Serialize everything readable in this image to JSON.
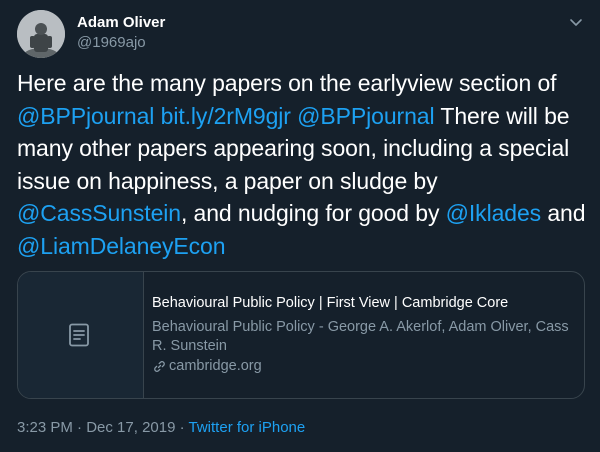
{
  "author": {
    "display_name": "Adam Oliver",
    "handle": "@1969ajo"
  },
  "tweet": {
    "segments": [
      {
        "text": "Here are the many papers on the earlyview section of ",
        "link": false
      },
      {
        "text": "@BPPjournal",
        "link": true
      },
      {
        "text": " ",
        "link": false
      },
      {
        "text": "bit.ly/2rM9gjr",
        "link": true
      },
      {
        "text": " ",
        "link": false
      },
      {
        "text": "@BPPjournal",
        "link": true
      },
      {
        "text": " There will be many other papers appearing soon, including a special issue on happiness, a paper on sludge by ",
        "link": false
      },
      {
        "text": "@CassSunstein",
        "link": true
      },
      {
        "text": ", and nudging for good by ",
        "link": false
      },
      {
        "text": "@Iklades",
        "link": true
      },
      {
        "text": " and ",
        "link": false
      },
      {
        "text": "@LiamDelaneyEcon",
        "link": true
      }
    ]
  },
  "card": {
    "title": "Behavioural Public Policy | First View | Cambridge Core",
    "description": "Behavioural Public Policy - George A. Akerlof, Adam Oliver, Cass R. Sunstein",
    "domain": "cambridge.org",
    "icon": "document-icon"
  },
  "meta": {
    "time": "3:23 PM",
    "separator": " · ",
    "date": "Dec 17, 2019",
    "separator2": " · ",
    "source": "Twitter for iPhone"
  },
  "colors": {
    "background": "#15202b",
    "link": "#1da1f2",
    "secondary": "#8899a6",
    "border": "#38444d"
  }
}
